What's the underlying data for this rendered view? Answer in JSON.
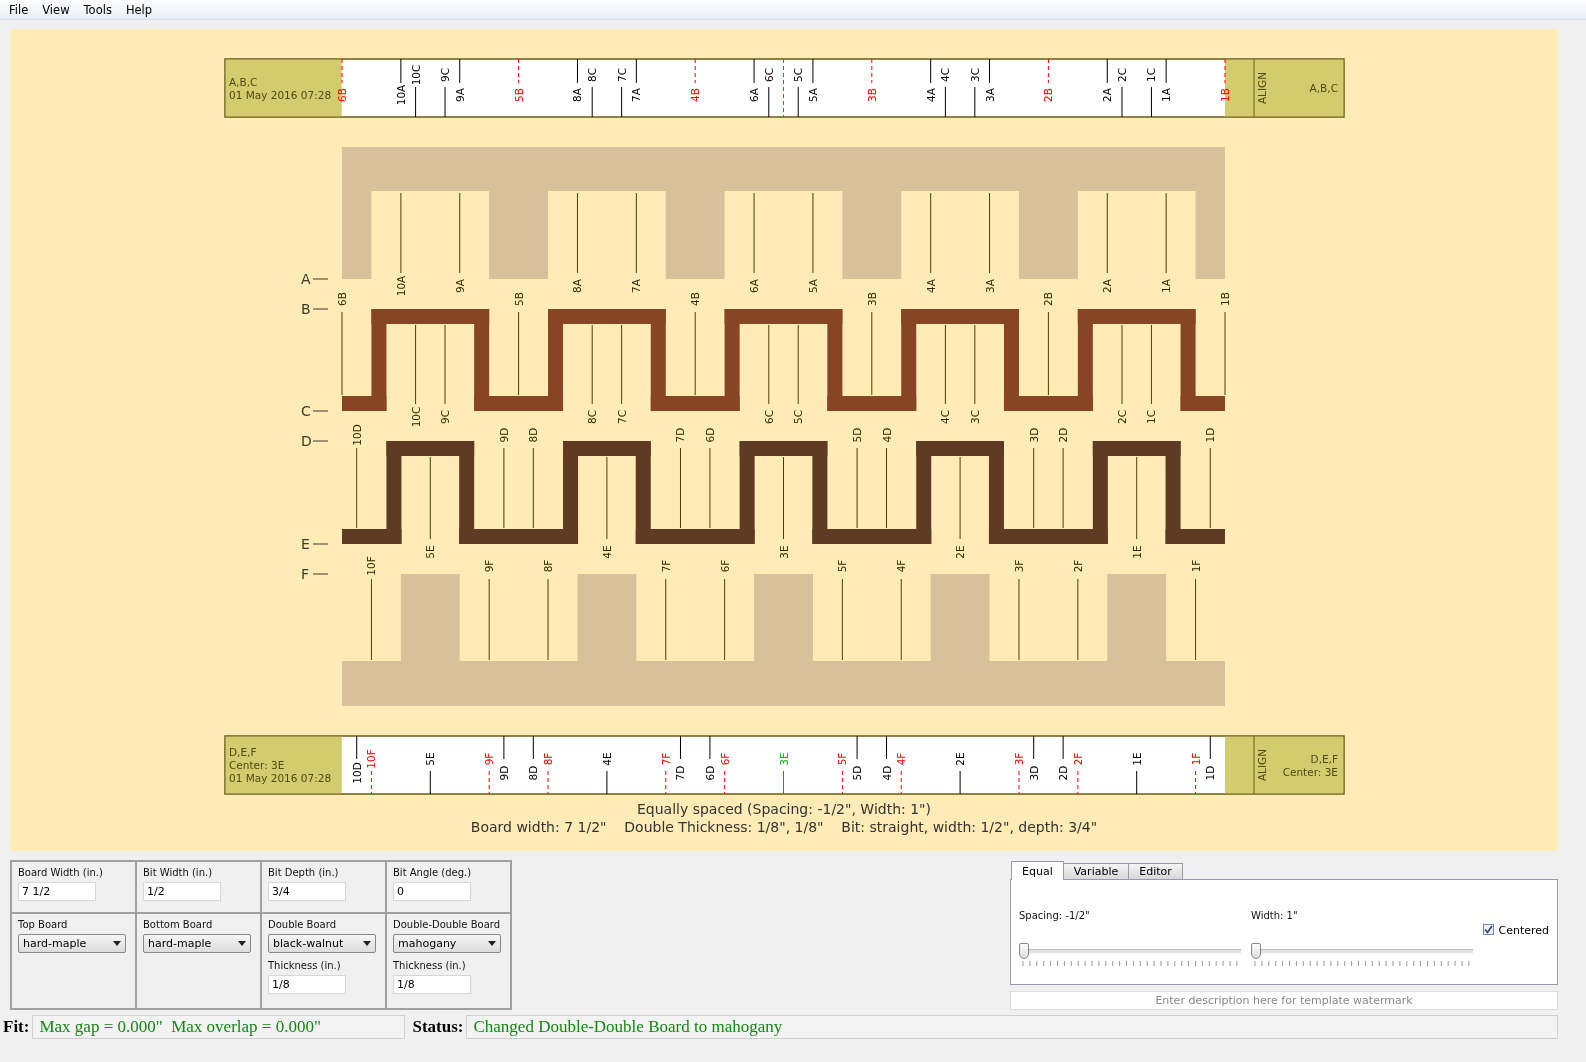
{
  "menu": [
    "File",
    "View",
    "Tools",
    "Help"
  ],
  "top_template": {
    "caption": [
      "A,B,C",
      "01 May 2016 07:28"
    ],
    "align": "ALIGN",
    "right_caption": [
      "A,B,C"
    ],
    "marks": [
      {
        "label": "6B",
        "kind": "b"
      },
      {
        "label": "10A",
        "kind": "a"
      },
      {
        "label": "10C",
        "kind": "c"
      },
      {
        "label": "9C",
        "kind": "c"
      },
      {
        "label": "9A",
        "kind": "a"
      },
      {
        "label": "5B",
        "kind": "b"
      },
      {
        "label": "8A",
        "kind": "a"
      },
      {
        "label": "8C",
        "kind": "c"
      },
      {
        "label": "7C",
        "kind": "c"
      },
      {
        "label": "7A",
        "kind": "a"
      },
      {
        "label": "4B",
        "kind": "b"
      },
      {
        "label": "6A",
        "kind": "a"
      },
      {
        "label": "6C",
        "kind": "c"
      },
      {
        "kind": "center"
      },
      {
        "label": "5C",
        "kind": "c"
      },
      {
        "label": "5A",
        "kind": "a"
      },
      {
        "label": "3B",
        "kind": "b"
      },
      {
        "label": "4A",
        "kind": "a"
      },
      {
        "label": "4C",
        "kind": "c"
      },
      {
        "label": "3C",
        "kind": "c"
      },
      {
        "label": "3A",
        "kind": "a"
      },
      {
        "label": "2B",
        "kind": "b"
      },
      {
        "label": "2A",
        "kind": "a"
      },
      {
        "label": "2C",
        "kind": "c"
      },
      {
        "label": "1C",
        "kind": "c"
      },
      {
        "label": "1A",
        "kind": "a"
      },
      {
        "label": "1B",
        "kind": "b"
      }
    ]
  },
  "joint": {
    "layer_labels": [
      "A",
      "B",
      "C",
      "D",
      "E",
      "F"
    ],
    "rows": [
      [
        {
          "label": "6B",
          "kind": "b"
        },
        {
          "label": "10A",
          "kind": "a"
        },
        {
          "label": "9A",
          "kind": "a"
        },
        {
          "label": "5B",
          "kind": "b"
        },
        {
          "label": "8A",
          "kind": "a"
        },
        {
          "label": "7A",
          "kind": "a"
        },
        {
          "label": "4B",
          "kind": "b"
        },
        {
          "label": "6A",
          "kind": "a"
        },
        {
          "label": "5A",
          "kind": "a"
        },
        {
          "label": "3B",
          "kind": "b"
        },
        {
          "label": "4A",
          "kind": "a"
        },
        {
          "label": "3A",
          "kind": "a"
        },
        {
          "label": "2B",
          "kind": "b"
        },
        {
          "label": "2A",
          "kind": "a"
        },
        {
          "label": "1A",
          "kind": "a"
        },
        {
          "label": "1B",
          "kind": "b"
        }
      ],
      [
        {
          "label": "10D",
          "kind": "d"
        },
        {
          "label": "10C",
          "kind": "c"
        },
        {
          "label": "9C",
          "kind": "c"
        },
        {
          "label": "9D",
          "kind": "d"
        },
        {
          "label": "8D",
          "kind": "d"
        },
        {
          "label": "8C",
          "kind": "c"
        },
        {
          "label": "7C",
          "kind": "c"
        },
        {
          "label": "7D",
          "kind": "d"
        },
        {
          "label": "6D",
          "kind": "d"
        },
        {
          "label": "6C",
          "kind": "c"
        },
        {
          "label": "5C",
          "kind": "c"
        },
        {
          "label": "5D",
          "kind": "d"
        },
        {
          "label": "4D",
          "kind": "d"
        },
        {
          "label": "4C",
          "kind": "c"
        },
        {
          "label": "3C",
          "kind": "c"
        },
        {
          "label": "3D",
          "kind": "d"
        },
        {
          "label": "2D",
          "kind": "d"
        },
        {
          "label": "2C",
          "kind": "c"
        },
        {
          "label": "1C",
          "kind": "c"
        },
        {
          "label": "1D",
          "kind": "d"
        }
      ],
      [
        {
          "label": "10F",
          "kind": "f"
        },
        {
          "label": "5E",
          "kind": "e"
        },
        {
          "label": "9F",
          "kind": "f"
        },
        {
          "label": "8F",
          "kind": "f"
        },
        {
          "label": "4E",
          "kind": "e"
        },
        {
          "label": "7F",
          "kind": "f"
        },
        {
          "label": "6F",
          "kind": "f"
        },
        {
          "label": "3E",
          "kind": "e"
        },
        {
          "label": "5F",
          "kind": "f"
        },
        {
          "label": "4F",
          "kind": "f"
        },
        {
          "label": "2E",
          "kind": "e"
        },
        {
          "label": "3F",
          "kind": "f"
        },
        {
          "label": "2F",
          "kind": "f"
        },
        {
          "label": "1E",
          "kind": "e"
        },
        {
          "label": "1F",
          "kind": "f"
        }
      ]
    ]
  },
  "bottom_template": {
    "caption": [
      "D,E,F",
      "Center: 3E",
      "01 May 2016 07:28"
    ],
    "align": "ALIGN",
    "right_caption": [
      "D,E,F",
      "Center: 3E"
    ],
    "marks": [
      {
        "label": "10D",
        "kind": "d"
      },
      {
        "label": "10F",
        "kind": "f"
      },
      {
        "label": "5E",
        "kind": "e"
      },
      {
        "label": "9F",
        "kind": "f"
      },
      {
        "label": "9D",
        "kind": "d"
      },
      {
        "label": "8D",
        "kind": "d"
      },
      {
        "label": "8F",
        "kind": "f"
      },
      {
        "label": "4E",
        "kind": "e"
      },
      {
        "label": "7F",
        "kind": "f"
      },
      {
        "label": "7D",
        "kind": "d"
      },
      {
        "label": "6D",
        "kind": "d"
      },
      {
        "label": "6F",
        "kind": "f"
      },
      {
        "label": "3E",
        "kind": "center"
      },
      {
        "label": "5F",
        "kind": "f"
      },
      {
        "label": "5D",
        "kind": "d"
      },
      {
        "label": "4D",
        "kind": "d"
      },
      {
        "label": "4F",
        "kind": "f"
      },
      {
        "label": "2E",
        "kind": "e"
      },
      {
        "label": "3F",
        "kind": "f"
      },
      {
        "label": "3D",
        "kind": "d"
      },
      {
        "label": "2D",
        "kind": "d"
      },
      {
        "label": "2F",
        "kind": "f"
      },
      {
        "label": "1E",
        "kind": "e"
      },
      {
        "label": "1F",
        "kind": "f"
      },
      {
        "label": "1D",
        "kind": "d"
      }
    ]
  },
  "description": [
    "Equally spaced (Spacing: -1/2\", Width: 1\")",
    "Board width: 7 1/2\"    Double Thickness: 1/8\", 1/8\"    Bit: straight, width: 1/2\", depth: 3/4\""
  ],
  "settings": [
    [
      {
        "label": "Board Width (in.)",
        "kind": "text",
        "value": "7 1/2"
      },
      {
        "label": "Bit Width (in.)",
        "kind": "text",
        "value": "1/2"
      },
      {
        "label": "Bit Depth (in.)",
        "kind": "text",
        "value": "3/4"
      },
      {
        "label": "Bit Angle (deg.)",
        "kind": "text",
        "value": "0"
      }
    ],
    [
      {
        "label": "Top Board",
        "kind": "select",
        "value": "hard-maple"
      },
      {
        "label": "Bottom Board",
        "kind": "select",
        "value": "hard-maple"
      },
      {
        "label": "Double Board",
        "kind": "select",
        "value": "black-walnut",
        "thickness": {
          "label": "Thickness (in.)",
          "value": "1/8"
        }
      },
      {
        "label": "Double-Double Board",
        "kind": "select",
        "value": "mahogany",
        "thickness": {
          "label": "Thickness (in.)",
          "value": "1/8"
        }
      }
    ]
  ],
  "tabs": [
    {
      "label": "Equal",
      "selected": true
    },
    {
      "label": "Variable",
      "selected": false
    },
    {
      "label": "Editor",
      "selected": false
    }
  ],
  "sliders": [
    {
      "label": "Spacing: -1/2\"",
      "level": 0
    },
    {
      "label": "Width: 1\"",
      "level": 0
    }
  ],
  "centered": {
    "label": "Centered",
    "checked": true
  },
  "watermark": {
    "placeholder": "Enter description here for template watermark"
  },
  "status_bar": {
    "fit_label": "Fit:",
    "fit": "Max gap = 0.000\"  Max overlap = 0.000\"",
    "status_label": "Status:",
    "status": "Changed Double-Double Board to mahogany"
  }
}
